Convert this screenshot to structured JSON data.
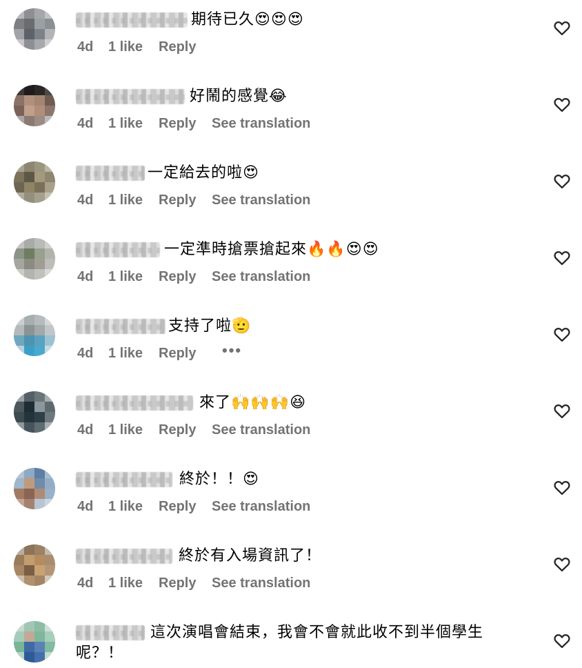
{
  "comments": [
    {
      "text": "期待已久😍😍😍",
      "time": "4d",
      "likes": "1 like",
      "reply": "Reply",
      "see_translation": ""
    },
    {
      "text": "好鬧的感覺😂",
      "time": "4d",
      "likes": "1 like",
      "reply": "Reply",
      "see_translation": "See translation"
    },
    {
      "text": "一定給去的啦😍",
      "time": "4d",
      "likes": "1 like",
      "reply": "Reply",
      "see_translation": "See translation"
    },
    {
      "text": "一定準時搶票搶起來🔥🔥😍😍",
      "time": "4d",
      "likes": "1 like",
      "reply": "Reply",
      "see_translation": "See translation"
    },
    {
      "text": "支持了啦🫡",
      "time": "4d",
      "likes": "1 like",
      "reply": "Reply",
      "see_translation": "",
      "more": "•••"
    },
    {
      "text": "來了🙌🙌🙌😆",
      "time": "4d",
      "likes": "1 like",
      "reply": "Reply",
      "see_translation": "See translation"
    },
    {
      "text": "終於！！😍",
      "time": "4d",
      "likes": "1 like",
      "reply": "Reply",
      "see_translation": "See translation"
    },
    {
      "text": "終於有入場資訊了！",
      "time": "4d",
      "likes": "1 like",
      "reply": "Reply",
      "see_translation": "See translation"
    },
    {
      "text": "這次演唱會結束，我會不會就此收不到半個學生呢？！",
      "time": "",
      "likes": "",
      "reply": "",
      "see_translation": ""
    }
  ],
  "icons": {
    "like": "heart-outline-icon",
    "more": "more-options-icon"
  },
  "colors": {
    "text": "#000000",
    "meta": "#737373",
    "background": "#ffffff"
  }
}
